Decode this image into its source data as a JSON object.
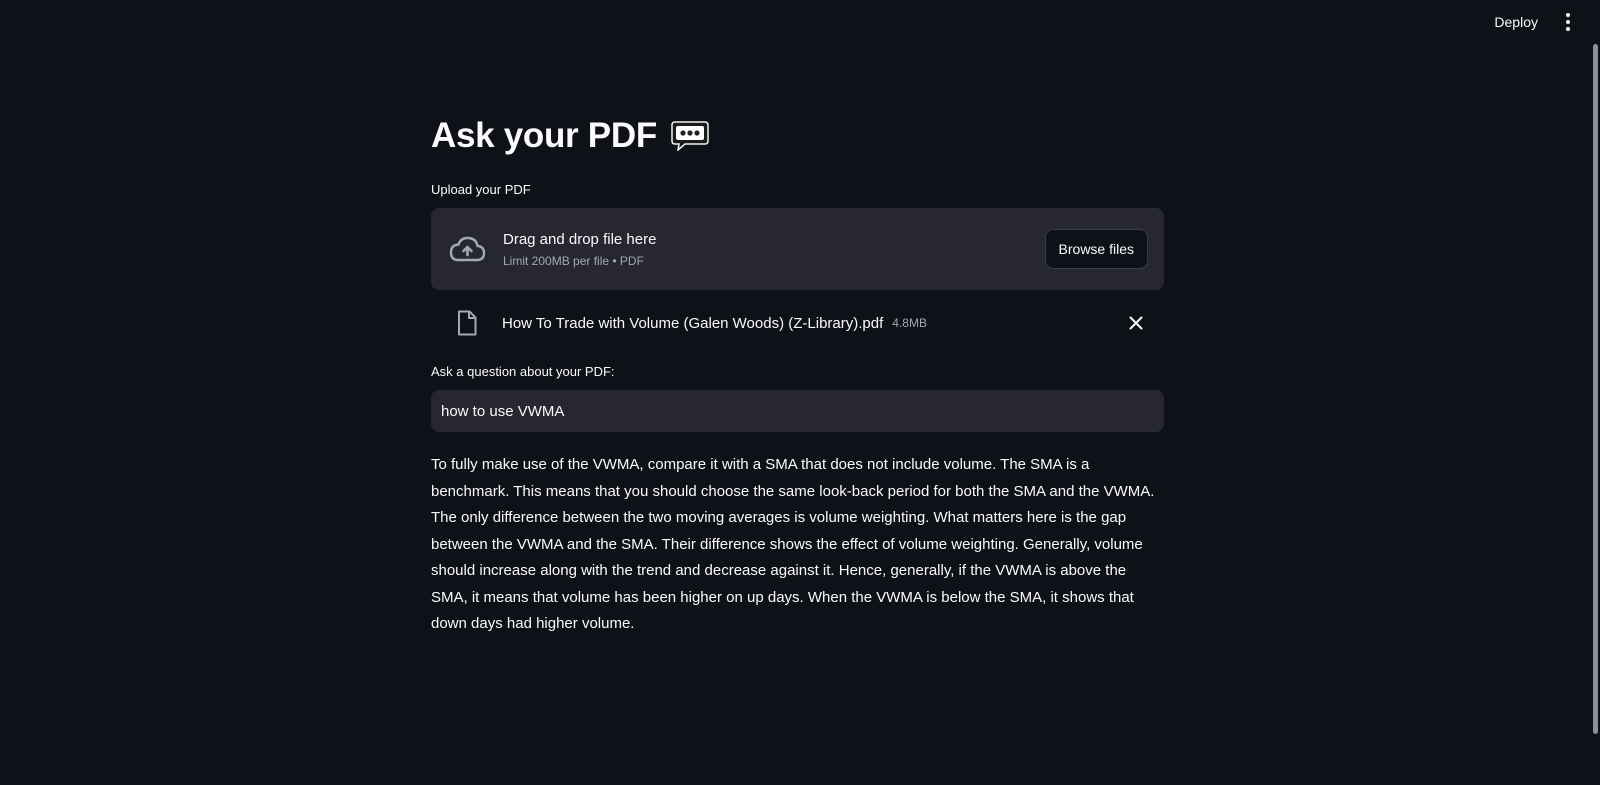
{
  "header": {
    "deploy_label": "Deploy",
    "menu_icon": "vertical-ellipsis-icon"
  },
  "page": {
    "title": "Ask your PDF",
    "title_emoji": "speech-bubble-icon"
  },
  "uploader": {
    "label": "Upload your PDF",
    "dropzone_text": "Drag and drop file here",
    "dropzone_limit": "Limit 200MB per file • PDF",
    "browse_label": "Browse files",
    "icon": "cloud-upload-icon"
  },
  "file": {
    "name": "How To Trade with Volume (Galen Woods) (Z-Library).pdf",
    "size": "4.8MB",
    "icon": "file-icon",
    "remove_icon": "close-icon"
  },
  "question": {
    "label": "Ask a question about your PDF:",
    "value": "how to use VWMA"
  },
  "answer": {
    "text": "To fully make use of the VWMA, compare it with a SMA that does not include volume. The SMA is a benchmark. This means that you should choose the same look-back period for both the SMA and the VWMA. The only difference between the two moving averages is volume weighting. What matters here is the gap between the VWMA and the SMA. Their difference shows the effect of volume weighting. Generally, volume should increase along with the trend and decrease against it. Hence, generally, if the VWMA is above the SMA, it means that volume has been higher on up days. When the VWMA is below the SMA, it shows that down days had higher volume."
  },
  "colors": {
    "background": "#0e1117",
    "surface": "#262730",
    "text": "#fafafa",
    "muted": "#a3a8b8"
  }
}
